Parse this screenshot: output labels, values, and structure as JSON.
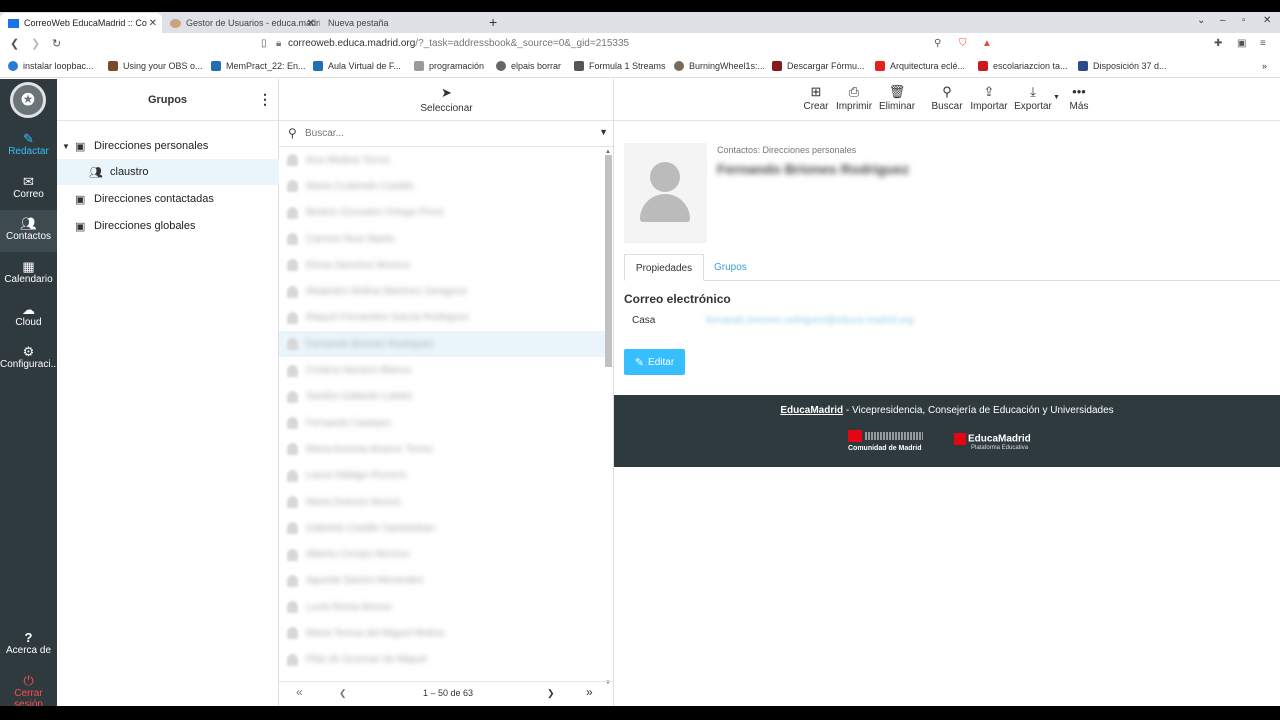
{
  "browser": {
    "tabs": [
      {
        "title": "CorreoWeb EducaMadrid :: Co",
        "active": true
      },
      {
        "title": "Gestor de Usuarios - educa.madrid",
        "active": false
      },
      {
        "title": "Nueva pestaña",
        "active": false
      }
    ],
    "url_host": "correoweb.educa.madrid.org",
    "url_path": "/?_task=addressbook&_source=0&_gid=215335",
    "bookmarks": [
      {
        "label": "instalar loopbac...",
        "color": "#2a7bd6"
      },
      {
        "label": "Using your OBS o...",
        "color": "#7a4b2a"
      },
      {
        "label": "MemPract_22: En...",
        "color": "#1f6fb2"
      },
      {
        "label": "Aula Virtual de F...",
        "color": "#1f6fb2"
      },
      {
        "label": "programación",
        "color": "#9a9a9a"
      },
      {
        "label": "elpais borrar",
        "color": "#666666"
      },
      {
        "label": "Formula 1 Streams",
        "color": "#555555"
      },
      {
        "label": "BurningWheel1s:...",
        "color": "#7a6a5a"
      },
      {
        "label": "Descargar Fórmu...",
        "color": "#8a1a1a"
      },
      {
        "label": "Arquitectura eclé...",
        "color": "#e62117"
      },
      {
        "label": "escolariazcion ta...",
        "color": "#cc1b1b"
      },
      {
        "label": "Disposición 37 d...",
        "color": "#2d4a8a"
      }
    ]
  },
  "nav": {
    "items": [
      {
        "label": "Redactar",
        "icon": "compose-icon"
      },
      {
        "label": "Correo",
        "icon": "envelope-icon"
      },
      {
        "label": "Contactos",
        "icon": "contacts-icon"
      },
      {
        "label": "Calendario",
        "icon": "calendar-icon"
      },
      {
        "label": "Cloud",
        "icon": "cloud-icon"
      },
      {
        "label": "Configuraci...",
        "icon": "gear-icon"
      }
    ],
    "about": "Acerca de",
    "logout": "Cerrar sesión"
  },
  "groups": {
    "title": "Grupos",
    "items": [
      {
        "label": "Direcciones personales"
      },
      {
        "label": "claustro"
      },
      {
        "label": "Direcciones contactadas"
      },
      {
        "label": "Direcciones globales"
      }
    ]
  },
  "contacts": {
    "select_label": "Seleccionar",
    "search_placeholder": "Buscar...",
    "names": [
      "Ana Medina Torres",
      "Marta Cuadrado Castillo",
      "Beatriz Gonzalez Ortega Perez",
      "Carmen Ruiz Martin",
      "Elena Sanchez Moreno",
      "Alejandro Molina Martinez Zaragoza",
      "Raquel Fernandez Garcia Rodriguez",
      "Fernando Briones Rodriguez",
      "Cristina Navarro Blanco",
      "Sandra Gallardo Lobato",
      "Fernando Castejon",
      "Maria Antonia Alvarez Torres",
      "Laura Hidalgo Romero",
      "Maria Dolores Munoz",
      "Gabriela Castillo Santisteban",
      "Alberto Crespo Moreno",
      "Agueda Santos Menendez",
      "Lucia Reina Alonso",
      "Maria Teresa del Miguel Molina",
      "Pilar de Guzman de Miguel"
    ],
    "selected_index": 7,
    "pager_text": "1 – 50 de 63"
  },
  "toolbar": {
    "buttons": [
      {
        "label": "Crear",
        "icon": "plus-square-icon"
      },
      {
        "label": "Imprimir",
        "icon": "printer-icon"
      },
      {
        "label": "Eliminar",
        "icon": "trash-icon"
      },
      {
        "label": "Buscar",
        "icon": "search-icon"
      },
      {
        "label": "Importar",
        "icon": "upload-icon"
      },
      {
        "label": "Exportar",
        "icon": "download-icon"
      },
      {
        "label": "Más",
        "icon": "dots-icon"
      }
    ]
  },
  "contact": {
    "context": "Contactos: Direcciones personales",
    "name": "Fernando Briones Rodriguez",
    "tabs": [
      "Propiedades",
      "Grupos"
    ],
    "section": "Correo electrónico",
    "field_label": "Casa",
    "field_value": "fernando.briones.rodriguez@educa.madrid.org",
    "edit_label": "Editar"
  },
  "footer": {
    "link": "EducaMadrid",
    "text": " - Vicepresidencia, Consejería de Educación y Universidades",
    "logo1": "Comunidad de Madrid",
    "logo2_title": "EducaMadrid",
    "logo2_sub": "Plataforma Educativa"
  },
  "colors": {
    "accent": "#37beff",
    "sidebar": "#2f3a3f",
    "selection": "#e9f5fb",
    "logout": "#ff4b4b"
  }
}
